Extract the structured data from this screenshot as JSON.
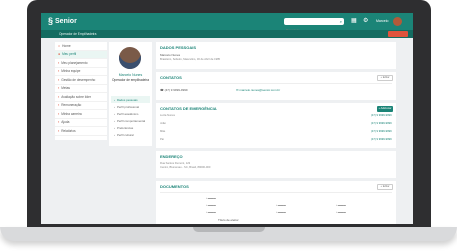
{
  "brand": {
    "name": "Senior"
  },
  "topbar": {
    "search_placeholder": "Pesquisar",
    "user": "Marcelo"
  },
  "subbar": {
    "crumb": "Operador de Empilhadeira"
  },
  "leftnav": {
    "items": [
      {
        "label": "Home"
      },
      {
        "label": "Meu perfil"
      },
      {
        "label": "Meu planejamento"
      },
      {
        "label": "Minha equipe"
      },
      {
        "label": "Gestão de desempenho"
      },
      {
        "label": "Metas"
      },
      {
        "label": "Avaliação sobre líder"
      },
      {
        "label": "Remuneração"
      },
      {
        "label": "Minha carreira"
      },
      {
        "label": "Ajuda"
      },
      {
        "label": "Relatórios"
      }
    ]
  },
  "profile": {
    "name": "Marcelo Nunes",
    "role": "Operador de empilhadeira",
    "menu": [
      {
        "label": "Dados pessoais"
      },
      {
        "label": "Perfil profissional"
      },
      {
        "label": "Perfil acadêmico"
      },
      {
        "label": "Perfil comportamental"
      },
      {
        "label": "Preferências"
      },
      {
        "label": "Perfil cultural"
      }
    ]
  },
  "cards": {
    "dados": {
      "title": "DADOS PESSOAIS",
      "line1": "Marcelo Nunes",
      "line2": "Brasileiro, Solteiro, Masculino, 30 de Abril de 1985"
    },
    "contatos": {
      "title": "CONTATOS",
      "btn": "+ Editar",
      "phone": "(47) 9 9999-9999",
      "email": "marcelo.nunes@senior.com.br"
    },
    "emergencia": {
      "title": "CONTATOS DE EMERGÊNCIA",
      "btn": "+ Adicionar",
      "rows": [
        {
          "name": "Luiza Nunes",
          "value": "(47) 9 9999-9999"
        },
        {
          "name": "João",
          "value": "(47) 9 9999-9999"
        },
        {
          "name": "Mãe",
          "value": "(47) 9 9999-9999"
        },
        {
          "name": "Pai",
          "value": "(47) 9 9999-9999"
        }
      ]
    },
    "endereco": {
      "title": "ENDEREÇO",
      "line1": "Rua Santos Dumont, 123",
      "line2": "Centro, Blumenau - SC, Brasil, 89000-000"
    },
    "documentos": {
      "title": "DOCUMENTOS",
      "btn": "+ Editar",
      "footer": "Título de eleitor"
    }
  }
}
